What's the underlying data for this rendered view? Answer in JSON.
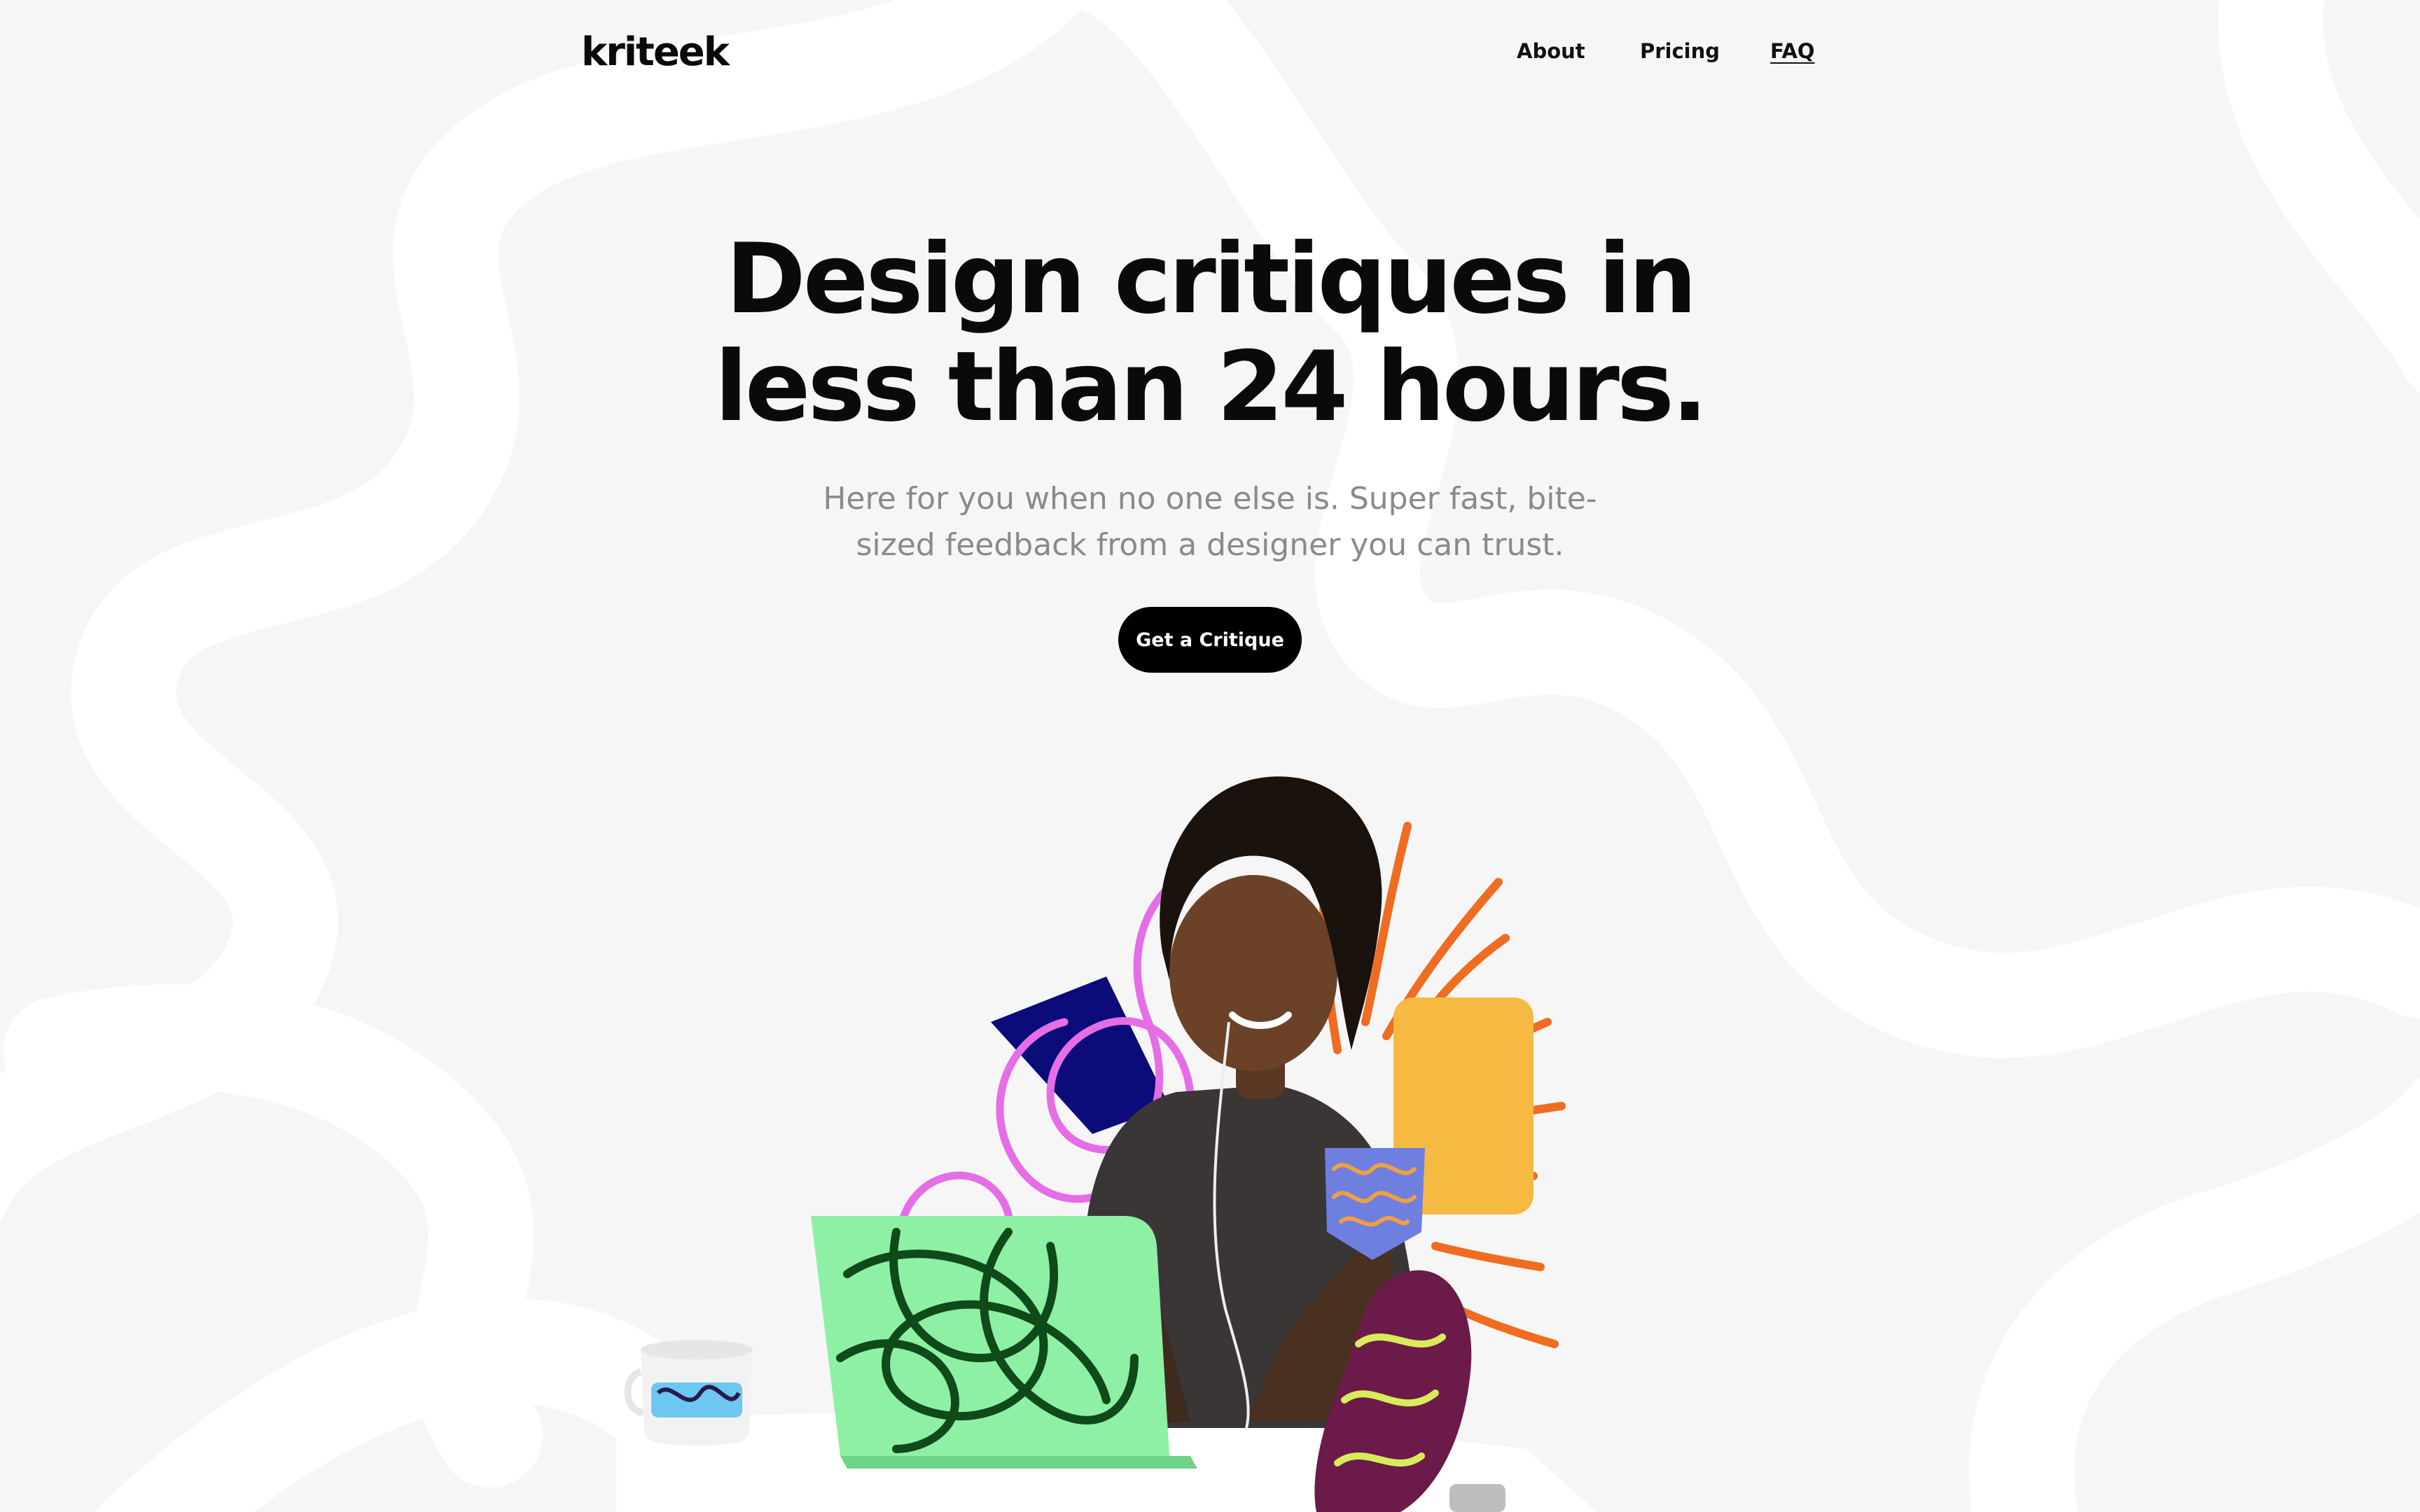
{
  "brand": {
    "logo": "kriteek"
  },
  "nav": {
    "items": [
      {
        "label": "About"
      },
      {
        "label": "Pricing"
      },
      {
        "label": "FAQ"
      }
    ]
  },
  "hero": {
    "headline_line1": "Design critiques in",
    "headline_line2": "less than 24 hours.",
    "subtitle": "Here for you when no one else is. Super fast, bite-sized feedback from a designer you can trust.",
    "cta_label": "Get a Critique"
  },
  "colors": {
    "background": "#f6f6f6",
    "squiggle": "#ffffff",
    "text": "#0a0a0a",
    "subtitle": "#8a8a8a",
    "button": "#000000",
    "button_text": "#ffffff",
    "laptop_green": "#8ef0a4",
    "navy_shape": "#0b0b7a",
    "pink_loops": "#e56ee6",
    "orange_rays": "#ef6c21",
    "yellow_square": "#f6b942",
    "maroon_blob": "#6b1a4a",
    "pocket_blue": "#6e7fe0"
  },
  "icons": {
    "illustration": "designer-at-laptop-illustration"
  }
}
